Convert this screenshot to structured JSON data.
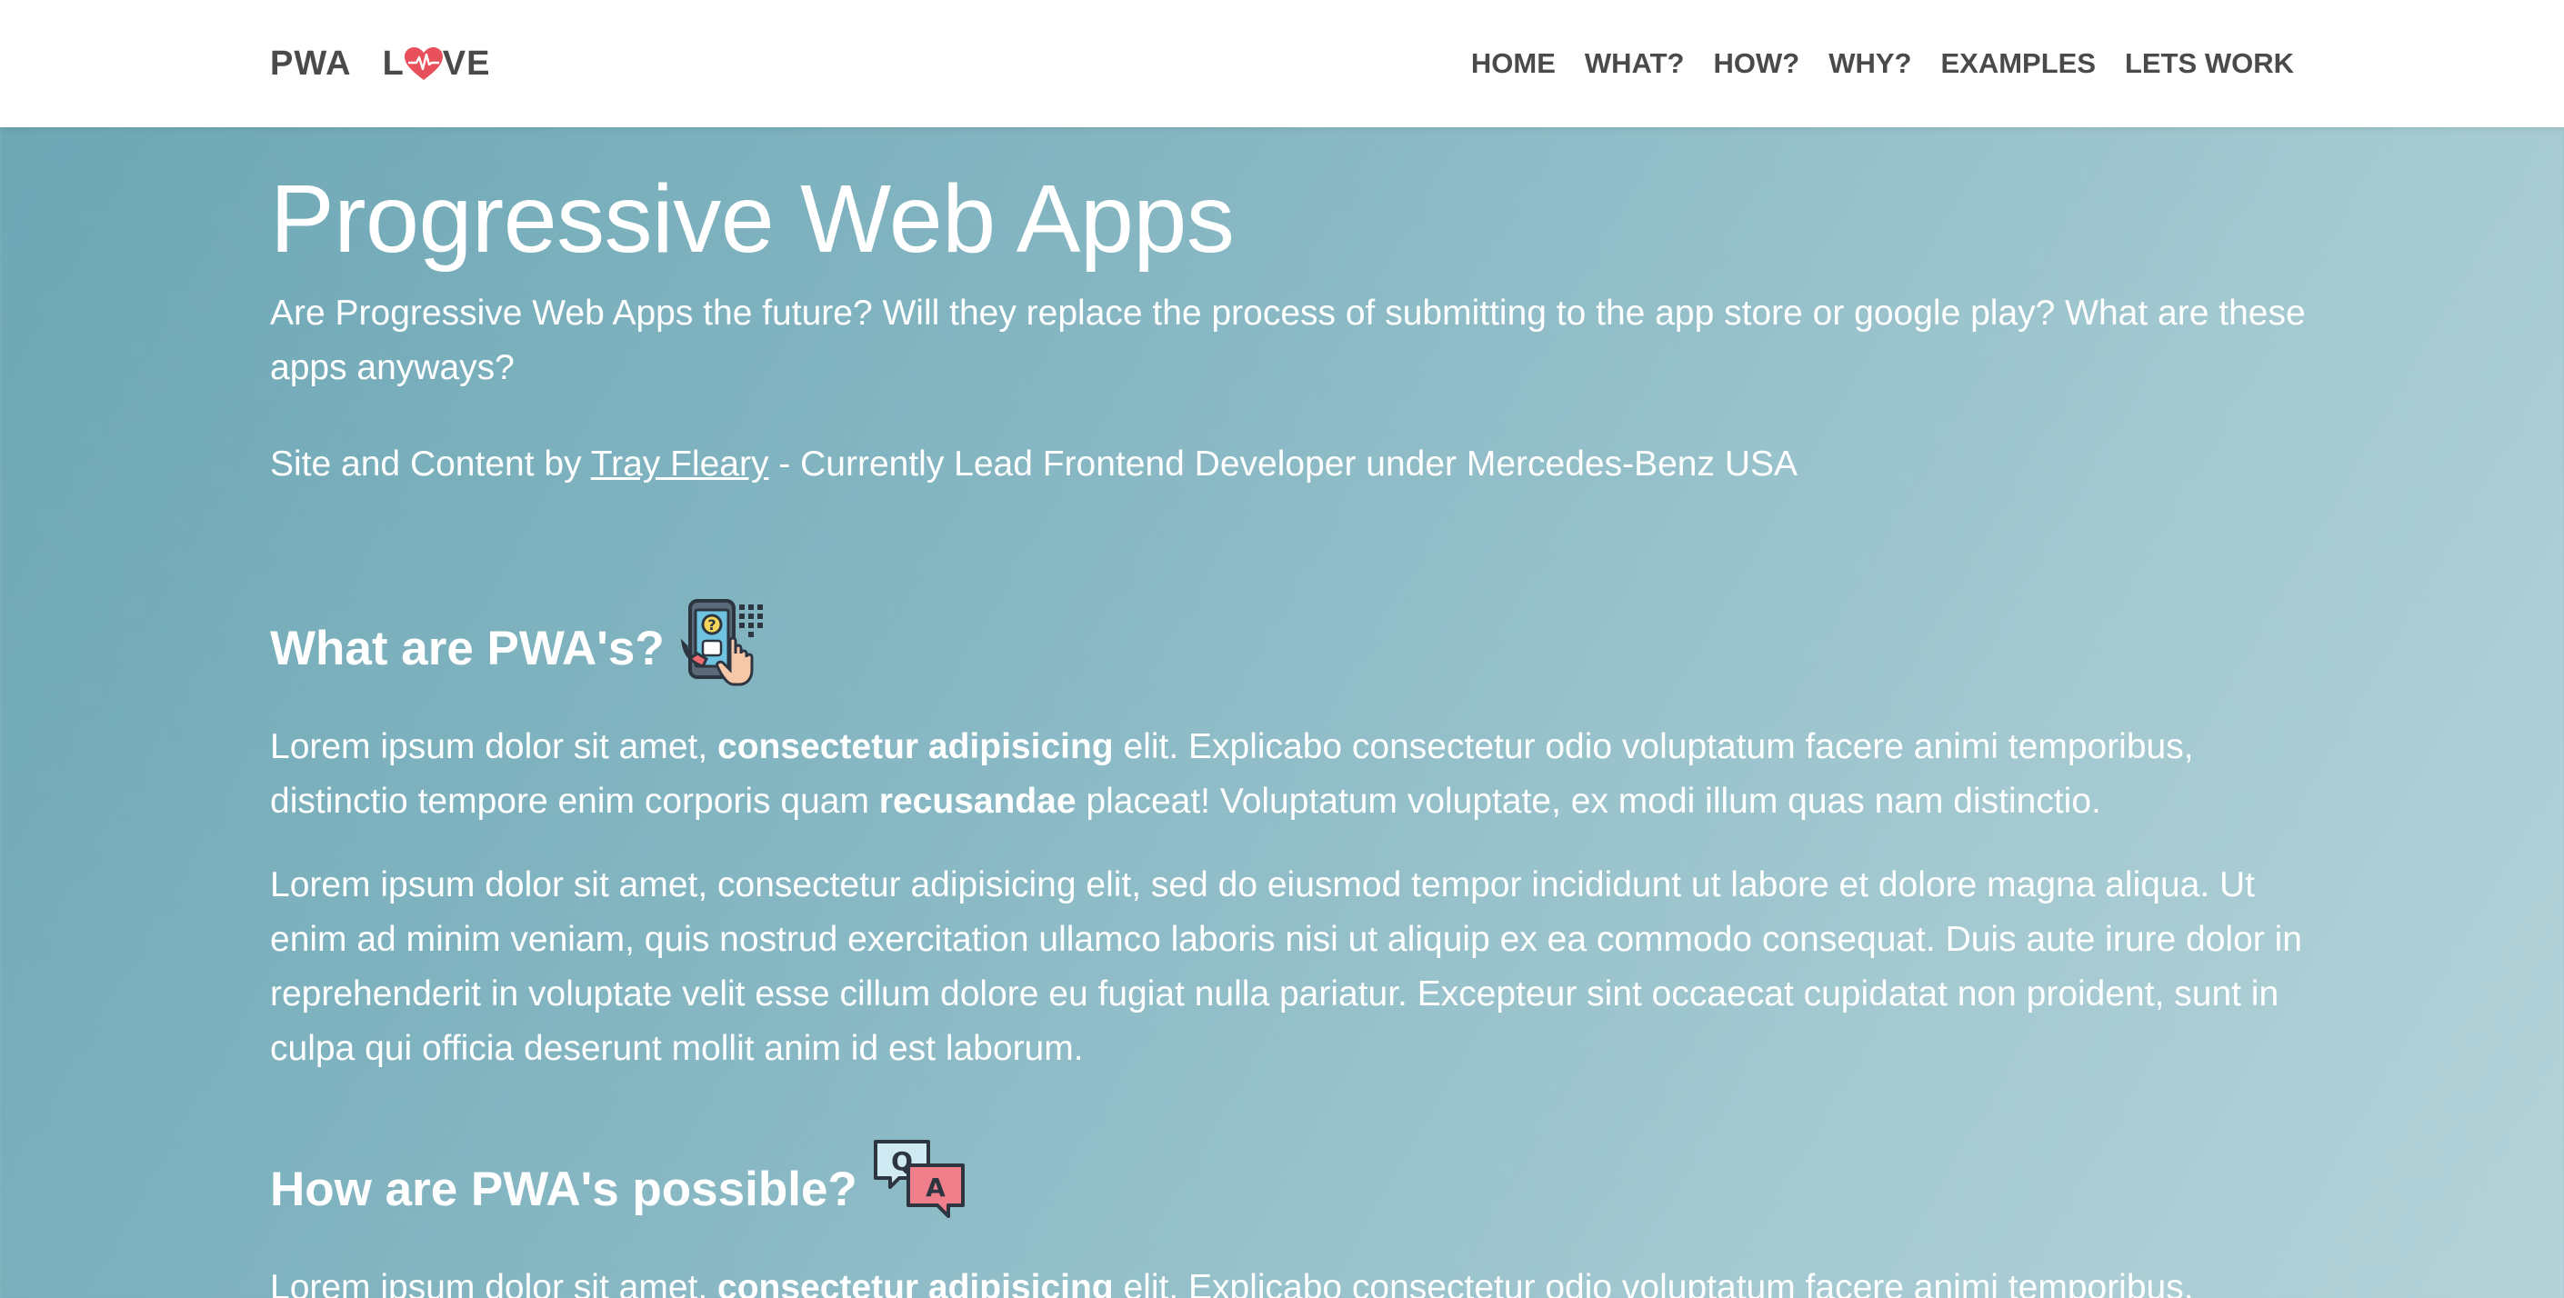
{
  "nav": {
    "brand_left": "PWA",
    "brand_l": "L",
    "brand_ve": "VE",
    "links": [
      "HOME",
      "WHAT?",
      "HOW?",
      "WHY?",
      "EXAMPLES",
      "LETS WORK"
    ]
  },
  "hero": {
    "title": "Progressive Web Apps",
    "subtitle": "Are Progressive Web Apps the future? Will they replace the process of submitting to the app store or google play? What are these apps anyways?",
    "credit_prefix": "Site and Content by ",
    "credit_link": "Tray Fleary",
    "credit_suffix": " - Currently Lead Frontend Developer under Mercedes-Benz USA"
  },
  "section_what": {
    "heading": "What are PWA's?",
    "icon": "phone-question-icon",
    "p1_a": "Lorem ipsum dolor sit amet, ",
    "p1_b": "consectetur adipisicing",
    "p1_c": " elit. Explicabo consectetur odio voluptatum facere animi temporibus, distinctio tempore enim corporis quam ",
    "p1_d": "recusandae",
    "p1_e": " placeat! Voluptatum voluptate, ex modi illum quas nam distinctio.",
    "p2": "Lorem ipsum dolor sit amet, consectetur adipisicing elit, sed do eiusmod tempor incididunt ut labore et dolore magna aliqua. Ut enim ad minim veniam, quis nostrud exercitation ullamco laboris nisi ut aliquip ex ea commodo consequat. Duis aute irure dolor in reprehenderit in voluptate velit esse cillum dolore eu fugiat nulla pariatur. Excepteur sint occaecat cupidatat non proident, sunt in culpa qui officia deserunt mollit anim id est laborum."
  },
  "section_how": {
    "heading": "How are PWA's possible?",
    "icon": "qa-chat-icon",
    "icon_q": "Q",
    "icon_a": "A",
    "p1_a": "Lorem ipsum dolor sit amet, ",
    "p1_b": "consectetur adipisicing",
    "p1_c": " elit. Explicabo consectetur odio voluptatum facere animi temporibus,"
  },
  "colors": {
    "heart": "#e8515b",
    "nav_text": "#4a4a4a",
    "bg_start": "#6ca6b4",
    "bg_end": "#b4d3d9"
  }
}
